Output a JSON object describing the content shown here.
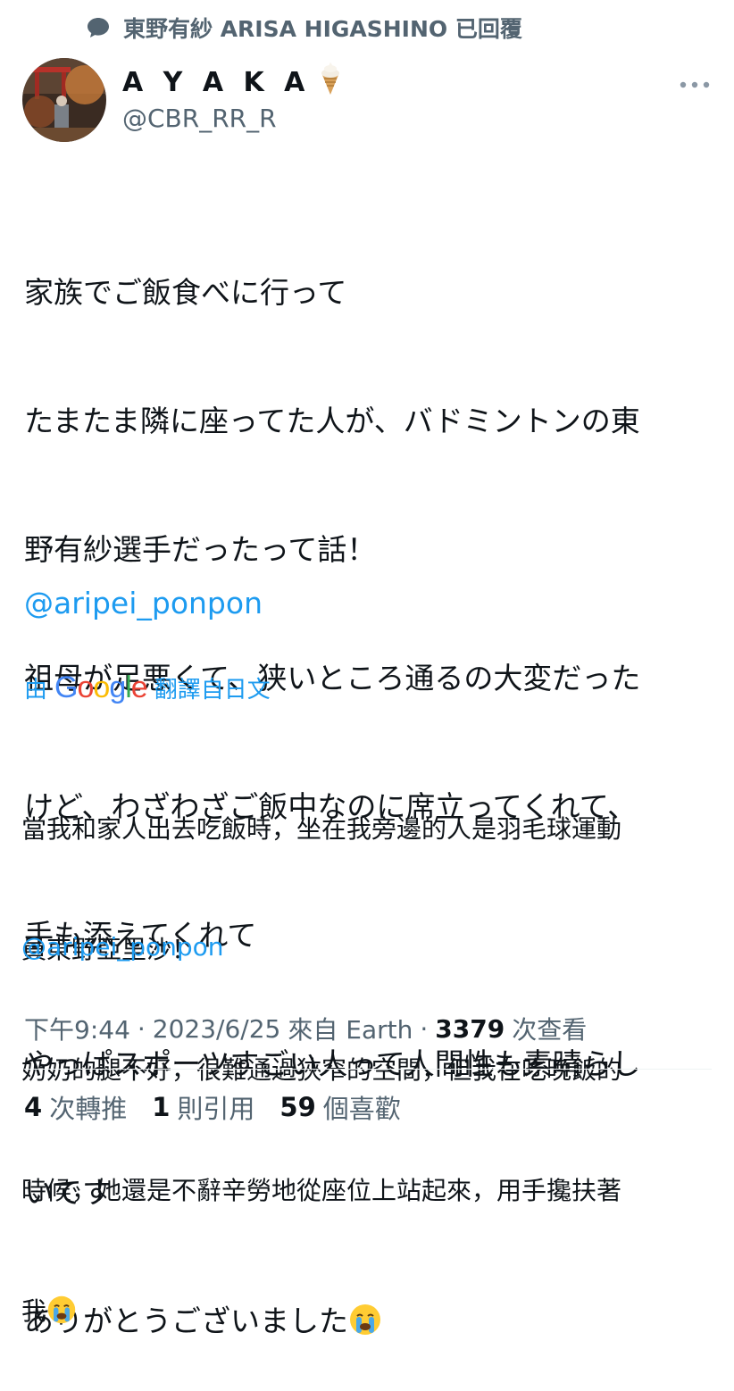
{
  "reply_context": {
    "text": "東野有紗 ARISA HIGASHINO 已回覆"
  },
  "author": {
    "display_name": "A Y A K A",
    "handle": "@CBR_RR_R",
    "name_emoji": "ice-cream-icon"
  },
  "tweet": {
    "lines": [
      "家族でご飯食べに行って",
      "たまたま隣に座ってた人が、バドミントンの東",
      "野有紗選手だったって話！",
      "祖母が足悪くて、狭いところ通るの大変だった",
      "けど、わざわざご飯中なのに席立ってくれて、",
      "手も添えてくれて",
      "やっぱスポーツすごい人って人間性も素晴らし",
      "いです",
      "ありがとうございました"
    ],
    "mention": "@aripei_ponpon"
  },
  "translation_label": {
    "prefix": "由",
    "brand": "Google",
    "suffix": "翻譯自日文"
  },
  "translation": {
    "lines": [
      "當我和家人出去吃飯時，坐在我旁邊的人是羽毛球運動",
      "員東野亞里沙！",
      "奶奶的腿不好，很難通過狹窄的空間，但我在吃晚飯的",
      "時候，她還是不辭辛勞地從座位上站起來，用手攙扶著",
      "我"
    ],
    "mention": "@aripei_ponpon"
  },
  "meta": {
    "time": "下午9:44",
    "date": "2023/6/25",
    "source": "來自 Earth",
    "views": "3379",
    "views_label": "次查看"
  },
  "stats": {
    "retweets": "4",
    "retweets_label": "次轉推",
    "quotes": "1",
    "quotes_label": "則引用",
    "likes": "59",
    "likes_label": "個喜歡"
  },
  "colors": {
    "link": "#1d9bf0",
    "secondary": "#536471",
    "text": "#0f1419"
  }
}
